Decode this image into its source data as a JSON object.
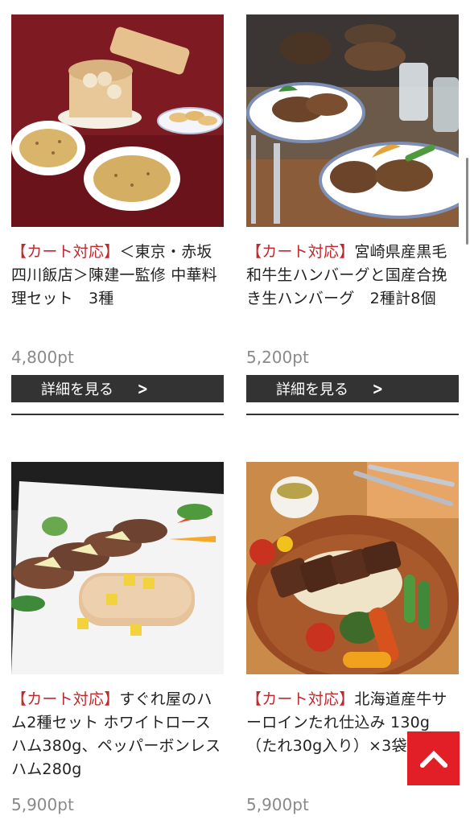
{
  "products": [
    {
      "tag": "【カート対応】",
      "name": "＜東京・赤坂四川飯店＞陳建一監修 中華料理セット　3種",
      "price": "4,800pt",
      "button": "詳細を見る"
    },
    {
      "tag": "【カート対応】",
      "name": "宮崎県産黒毛和牛生ハンバーグと国産合挽き生ハンバーグ　2種計8個",
      "price": "5,200pt",
      "button": "詳細を見る"
    },
    {
      "tag": "【カート対応】",
      "name": "すぐれ屋のハム2種セット ホワイトロースハム380g、ペッパーボンレスハム280g",
      "price": "5,900pt"
    },
    {
      "tag": "【カート対応】",
      "name": "北海道産牛サーロインたれ仕込み 130g（たれ30g入り）×3袋",
      "price": "5,900pt"
    }
  ],
  "colors": {
    "tag": "#c0282d",
    "button_bg": "#333333",
    "to_top_bg": "#e21f27",
    "price": "#8a8a8a"
  },
  "icons": {
    "button_chevron": "chevron-right-icon",
    "to_top": "chevron-up-icon"
  }
}
